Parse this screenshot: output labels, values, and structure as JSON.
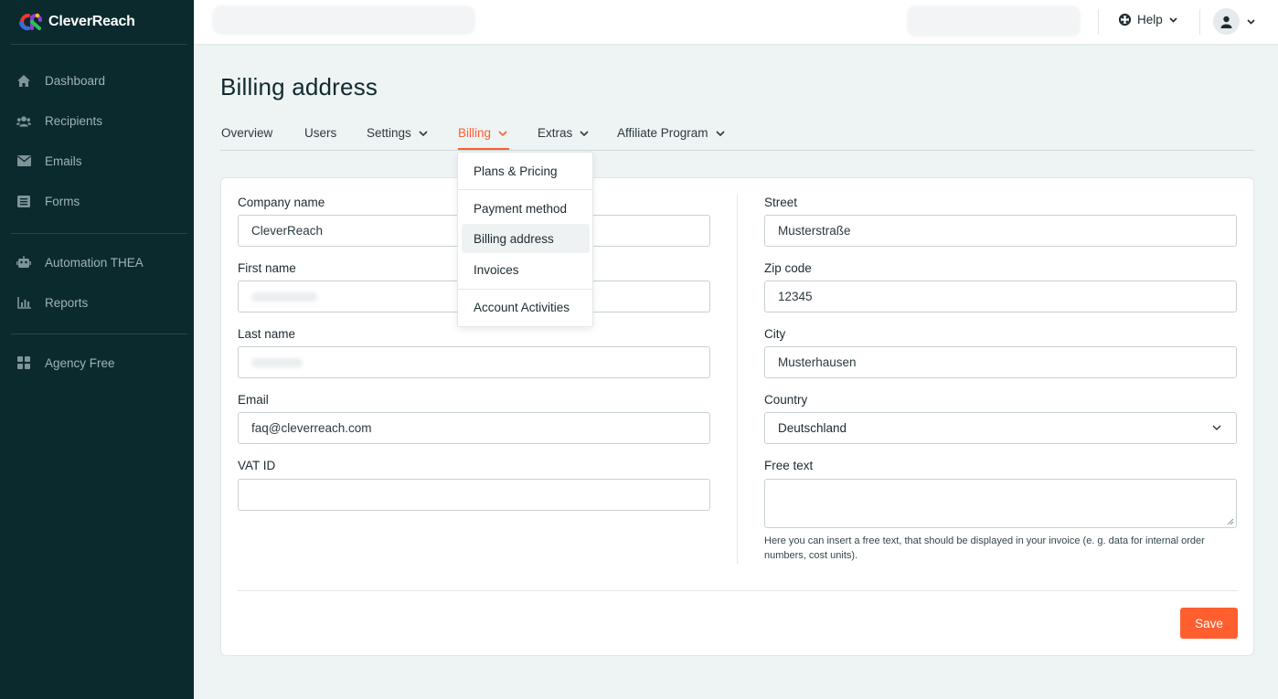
{
  "app": {
    "brand": "CleverReach",
    "brand_colors": {
      "red": "#e8392f",
      "blue": "#2f6fe0",
      "green": "#2fbf5c",
      "yellow": "#f5c12e",
      "purple": "#8b3fd1"
    }
  },
  "sidebar": {
    "items": [
      {
        "label": "Dashboard",
        "icon": "home-icon"
      },
      {
        "label": "Recipients",
        "icon": "users-icon"
      },
      {
        "label": "Emails",
        "icon": "envelope-icon"
      },
      {
        "label": "Forms",
        "icon": "form-icon"
      },
      {
        "label": "Automation THEA",
        "icon": "robot-icon"
      },
      {
        "label": "Reports",
        "icon": "chart-icon"
      },
      {
        "label": "Agency Free",
        "icon": "grid-icon"
      }
    ]
  },
  "topbar": {
    "help_label": "Help",
    "help_icon": "lifebuoy-icon",
    "user_icon": "user-icon"
  },
  "page": {
    "title": "Billing address"
  },
  "tabs": [
    {
      "label": "Overview",
      "has_menu": false
    },
    {
      "label": "Users",
      "has_menu": false
    },
    {
      "label": "Settings",
      "has_menu": true
    },
    {
      "label": "Billing",
      "has_menu": true,
      "active": true
    },
    {
      "label": "Extras",
      "has_menu": true
    },
    {
      "label": "Affiliate Program",
      "has_menu": true
    }
  ],
  "billing_menu": {
    "items": [
      "Plans & Pricing",
      "Payment method",
      "Billing address",
      "Invoices",
      "Account Activities"
    ],
    "selected": "Billing address"
  },
  "form": {
    "left": {
      "company_name": {
        "label": "Company name",
        "value": "CleverReach"
      },
      "first_name": {
        "label": "First name",
        "value": ""
      },
      "last_name": {
        "label": "Last name",
        "value": ""
      },
      "email": {
        "label": "Email",
        "value": "faq@cleverreach.com"
      },
      "vat_id": {
        "label": "VAT ID",
        "value": ""
      }
    },
    "right": {
      "street": {
        "label": "Street",
        "value": "Musterstraße"
      },
      "zip": {
        "label": "Zip code",
        "value": "12345"
      },
      "city": {
        "label": "City",
        "value": "Musterhausen"
      },
      "country": {
        "label": "Country",
        "value": "Deutschland"
      },
      "free_text": {
        "label": "Free text",
        "value": "",
        "hint": "Here you can insert a free text, that should be displayed in your invoice (e. g. data for internal order numbers, cost units)."
      }
    },
    "save_label": "Save"
  },
  "colors": {
    "accent": "#ff5f2e",
    "sidebar_bg": "#0b2a2e",
    "page_bg": "#eef3f4"
  }
}
